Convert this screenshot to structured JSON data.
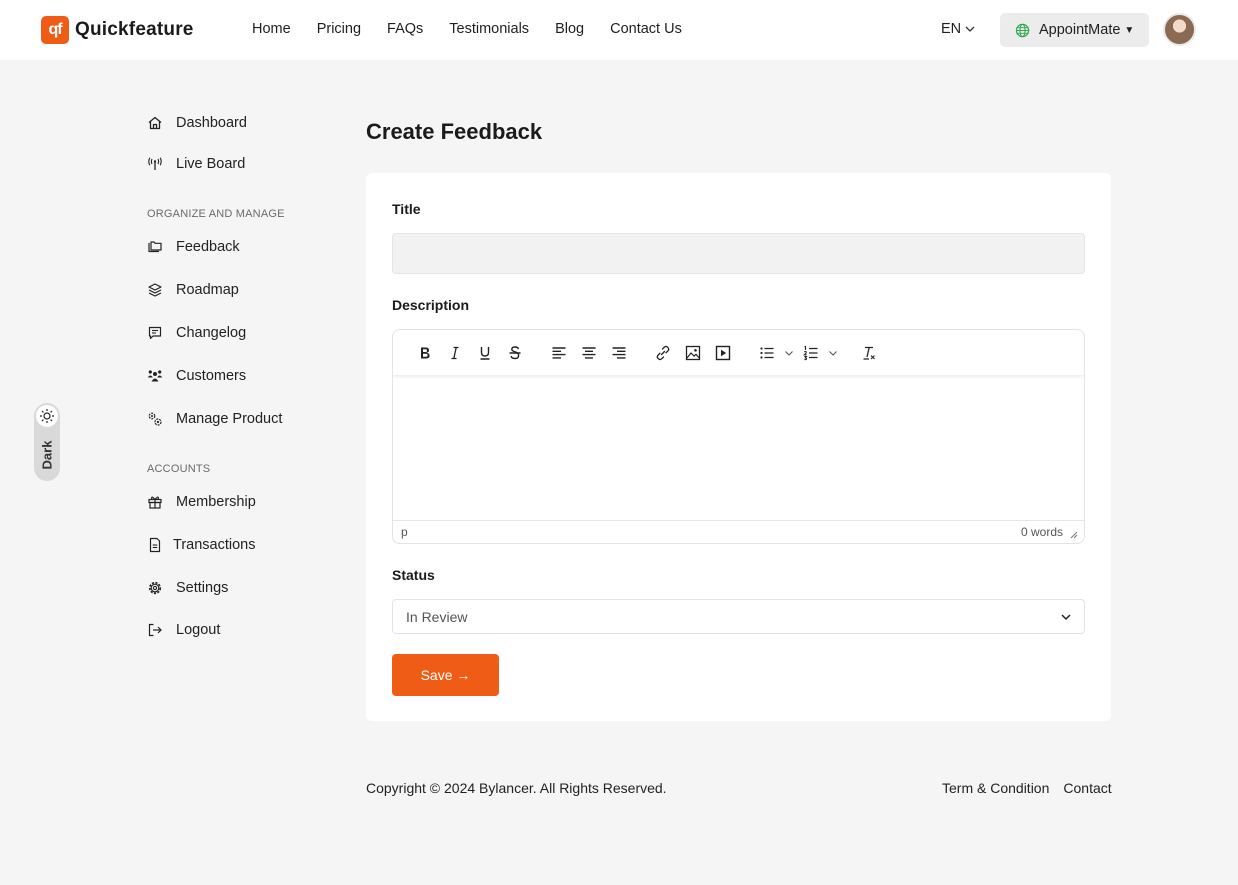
{
  "brand": {
    "mark": "qf",
    "name": "Quickfeature",
    "accent": "#ee5c15"
  },
  "nav": [
    "Home",
    "Pricing",
    "FAQs",
    "Testimonials",
    "Blog",
    "Contact Us"
  ],
  "header": {
    "language": "EN",
    "workspace": "AppointMate"
  },
  "sidebar": {
    "top": [
      {
        "label": "Dashboard",
        "icon": "home-icon"
      },
      {
        "label": "Live Board",
        "icon": "broadcast-icon"
      }
    ],
    "section1": "ORGANIZE AND MANAGE",
    "organize": [
      {
        "label": "Feedback",
        "icon": "folders-icon"
      },
      {
        "label": "Roadmap",
        "icon": "layers-icon"
      },
      {
        "label": "Changelog",
        "icon": "message-icon"
      },
      {
        "label": "Customers",
        "icon": "users-icon"
      },
      {
        "label": "Manage Product",
        "icon": "gears-icon"
      }
    ],
    "section2": "ACCOUNTS",
    "accounts": [
      {
        "label": "Membership",
        "icon": "gift-icon"
      },
      {
        "label": "Transactions",
        "icon": "document-icon"
      },
      {
        "label": "Settings",
        "icon": "settings-icon"
      },
      {
        "label": "Logout",
        "icon": "logout-icon"
      }
    ]
  },
  "theme_toggle": {
    "label": "Dark"
  },
  "page": {
    "title": "Create Feedback"
  },
  "form": {
    "title_label": "Title",
    "title_value": "",
    "description_label": "Description",
    "editor_path": "p",
    "word_count": "0 words",
    "status_label": "Status",
    "status_value": "In Review",
    "save_label": "Save →"
  },
  "footer": {
    "copyright": "Copyright © 2024 Bylancer. All Rights Reserved.",
    "links": [
      "Term & Condition",
      "Contact"
    ]
  }
}
